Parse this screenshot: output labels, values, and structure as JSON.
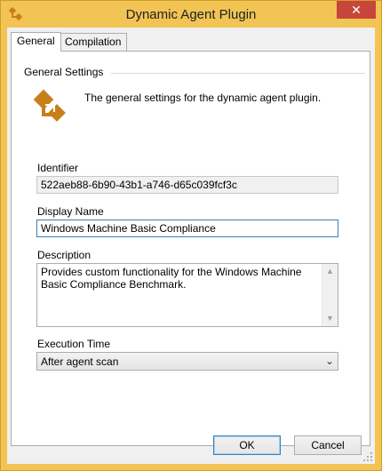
{
  "window": {
    "title": "Dynamic Agent Plugin",
    "close_label": "✕"
  },
  "tabs": [
    {
      "label": "General",
      "active": true
    },
    {
      "label": "Compilation",
      "active": false
    }
  ],
  "general": {
    "group_title": "General Settings",
    "description": "The general settings for the dynamic agent plugin.",
    "identifier": {
      "label": "Identifier",
      "value": "522aeb88-6b90-43b1-a746-d65c039fcf3c"
    },
    "display_name": {
      "label": "Display Name",
      "value": "Windows Machine Basic Compliance"
    },
    "plugin_description": {
      "label": "Description",
      "value": "Provides custom functionality for the Windows Machine Basic Compliance Benchmark."
    },
    "execution_time": {
      "label": "Execution Time",
      "selected": "After agent scan"
    }
  },
  "buttons": {
    "ok": "OK",
    "cancel": "Cancel"
  },
  "colors": {
    "frame": "#f1c454",
    "close": "#c7463b",
    "icon": "#c87f1a"
  },
  "icons": {
    "app": "plugin-icon",
    "close": "close-icon",
    "dropdown": "chevron-down-icon"
  }
}
